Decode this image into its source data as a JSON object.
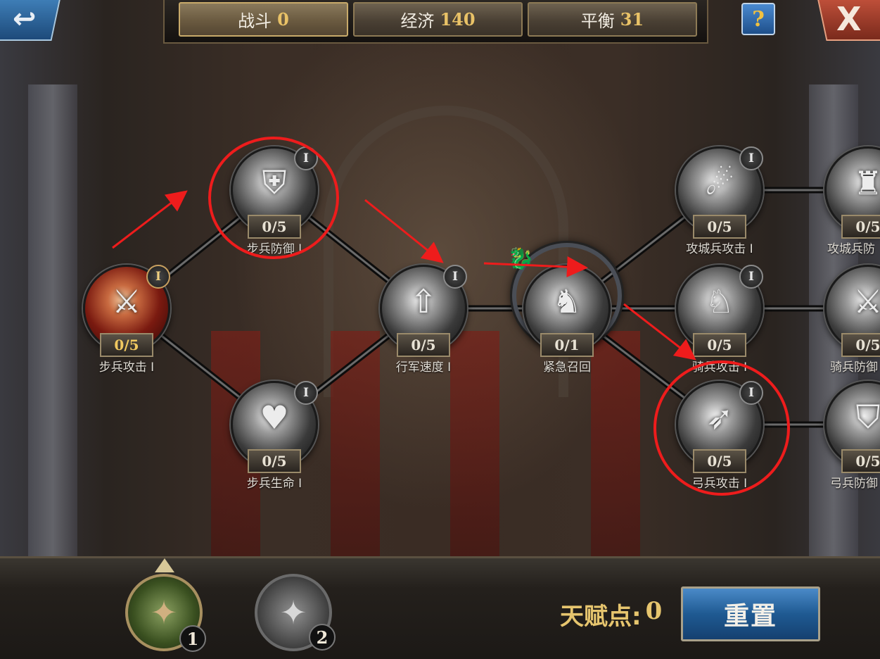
{
  "header": {
    "tabs": [
      {
        "label": "战斗",
        "value": "0"
      },
      {
        "label": "经济",
        "value": "140"
      },
      {
        "label": "平衡",
        "value": "31"
      }
    ],
    "help_label": "?",
    "close_label": "X",
    "back_icon": "back-arrow-icon"
  },
  "nodes": {
    "infantry_attack": {
      "name": "步兵攻击 I",
      "count": "0/5",
      "tier": "I"
    },
    "infantry_defense": {
      "name": "步兵防御 I",
      "count": "0/5",
      "tier": "I"
    },
    "infantry_health": {
      "name": "步兵生命 I",
      "count": "0/5",
      "tier": "I"
    },
    "march_speed": {
      "name": "行军速度 I",
      "count": "0/5",
      "tier": "I"
    },
    "emergency_recall": {
      "name": "紧急召回",
      "count": "0/1"
    },
    "siege_attack": {
      "name": "攻城兵攻击 I",
      "count": "0/5",
      "tier": "I"
    },
    "siege_defense": {
      "name": "攻城兵防",
      "count": "0/5"
    },
    "cavalry_attack": {
      "name": "骑兵攻击 I",
      "count": "0/5",
      "tier": "I"
    },
    "cavalry_defense": {
      "name": "骑兵防御",
      "count": "0/5"
    },
    "archer_attack": {
      "name": "弓兵攻击 I",
      "count": "0/5",
      "tier": "I"
    },
    "archer_defense": {
      "name": "弓兵防御",
      "count": "0/5"
    }
  },
  "footer": {
    "book1_number": "1",
    "book2_number": "2",
    "talent_label": "天赋点:",
    "talent_points": "0",
    "reset_label": "重置"
  },
  "colors": {
    "annotation": "#ee1c1c",
    "accent_gold": "#e9c267",
    "button_blue": "#1f5a92"
  }
}
